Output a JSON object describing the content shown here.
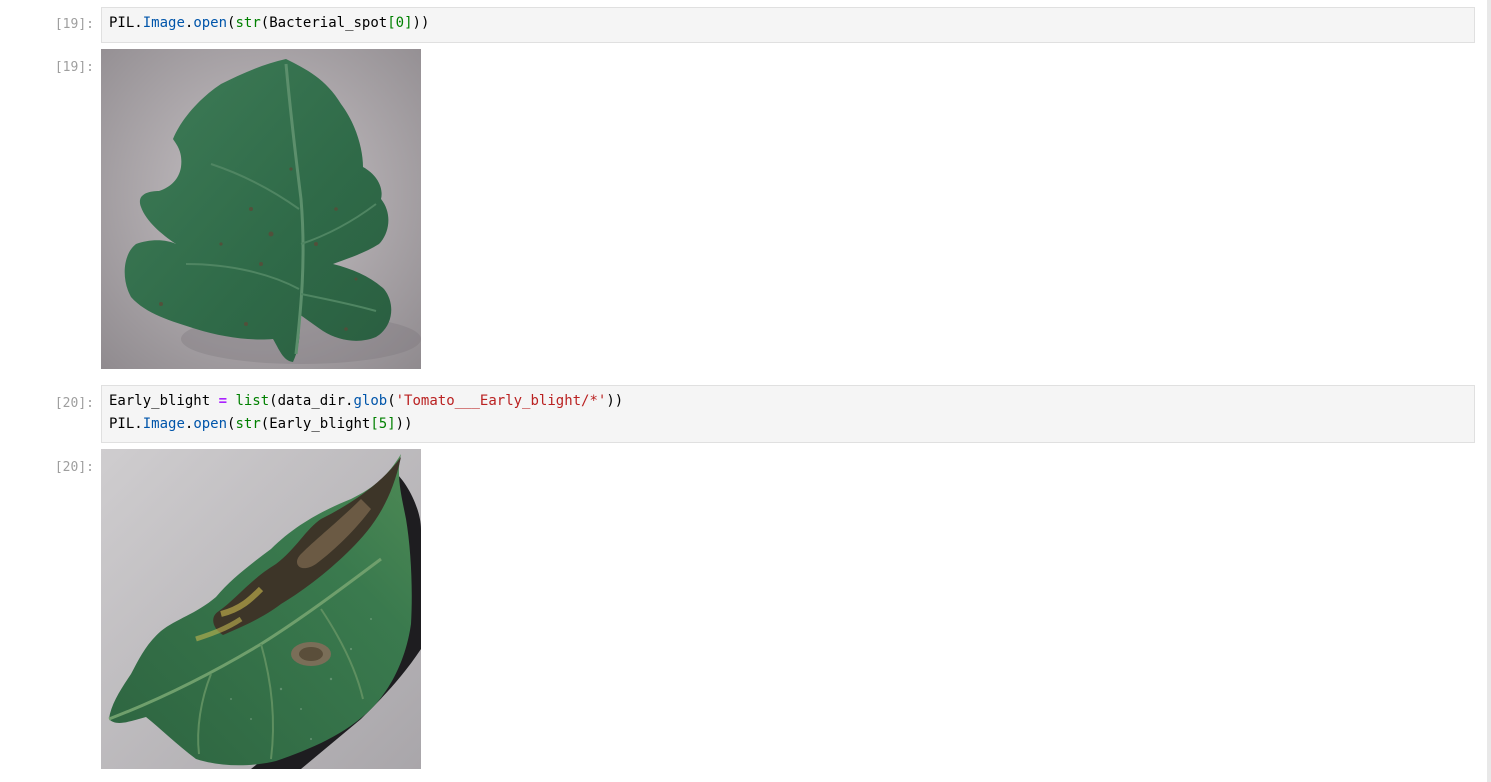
{
  "cells": [
    {
      "input_prompt": "[19]:",
      "code": [
        [
          {
            "t": "PIL",
            "c": "plain"
          },
          {
            "t": ".",
            "c": "plain"
          },
          {
            "t": "Image",
            "c": "attr"
          },
          {
            "t": ".",
            "c": "plain"
          },
          {
            "t": "open",
            "c": "attr"
          },
          {
            "t": "(",
            "c": "plain"
          },
          {
            "t": "str",
            "c": "builtin"
          },
          {
            "t": "(Bacterial_spot",
            "c": "plain"
          },
          {
            "t": "[",
            "c": "num"
          },
          {
            "t": "0",
            "c": "num"
          },
          {
            "t": "]",
            "c": "num"
          },
          {
            "t": "))",
            "c": "plain"
          }
        ]
      ],
      "output_prompt": "[19]:",
      "output_image": "tomato-leaf-bacterial-spot"
    },
    {
      "input_prompt": "[20]:",
      "code": [
        [
          {
            "t": "Early_blight ",
            "c": "plain"
          },
          {
            "t": "=",
            "c": "op"
          },
          {
            "t": " ",
            "c": "plain"
          },
          {
            "t": "list",
            "c": "builtin"
          },
          {
            "t": "(data_dir",
            "c": "plain"
          },
          {
            "t": ".",
            "c": "plain"
          },
          {
            "t": "glob",
            "c": "attr"
          },
          {
            "t": "(",
            "c": "plain"
          },
          {
            "t": "'Tomato___Early_blight/*'",
            "c": "str"
          },
          {
            "t": "))",
            "c": "plain"
          }
        ],
        [
          {
            "t": "PIL",
            "c": "plain"
          },
          {
            "t": ".",
            "c": "plain"
          },
          {
            "t": "Image",
            "c": "attr"
          },
          {
            "t": ".",
            "c": "plain"
          },
          {
            "t": "open",
            "c": "attr"
          },
          {
            "t": "(",
            "c": "plain"
          },
          {
            "t": "str",
            "c": "builtin"
          },
          {
            "t": "(Early_blight",
            "c": "plain"
          },
          {
            "t": "[",
            "c": "num"
          },
          {
            "t": "5",
            "c": "num"
          },
          {
            "t": "]",
            "c": "num"
          },
          {
            "t": "))",
            "c": "plain"
          }
        ]
      ],
      "output_prompt": "[20]:",
      "output_image": "tomato-leaf-early-blight"
    }
  ],
  "colors": {
    "prompt": "#9e9e9e",
    "input_bg": "#f5f5f5",
    "input_border": "#e0e0e0",
    "attr": "#0055aa",
    "builtin": "#008000",
    "op": "#aa22ff",
    "str": "#ba2121"
  }
}
